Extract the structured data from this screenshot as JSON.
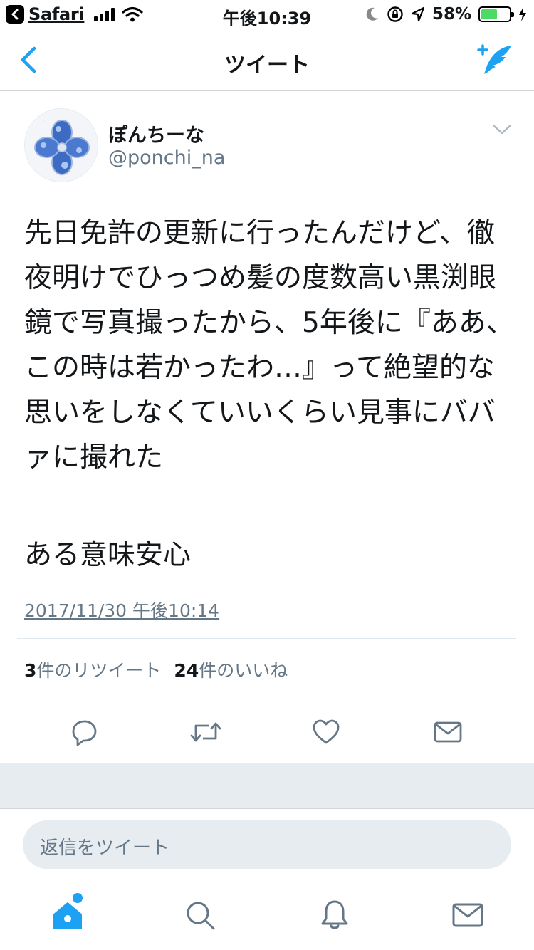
{
  "status_bar": {
    "back_app": "Safari",
    "time": "午後10:39",
    "battery": "58%",
    "battery_level": 0.58
  },
  "nav": {
    "title": "ツイート"
  },
  "tweet": {
    "display_name": "ぽんちーな",
    "screen_name": "@ponchi_na",
    "text": "先日免許の更新に行ったんだけど、徹夜明けでひっつめ髪の度数高い黒渕眼鏡で写真撮ったから、5年後に『ああ、この時は若かったわ…』って絶望的な思いをしなくていいくらい見事にババァに撮れた",
    "text_2": "ある意味安心",
    "timestamp": "2017/11/30 午後10:14",
    "retweet_count": "3",
    "retweet_label": "件のリツイート",
    "like_count": "24",
    "like_label": "件のいいね"
  },
  "reply": {
    "placeholder": "返信をツイート"
  },
  "colors": {
    "accent": "#1da1f2",
    "icon_gray": "#657786",
    "gap_background": "#e6ecf0"
  },
  "icons": {
    "actions": [
      "reply-icon",
      "retweet-icon",
      "like-icon",
      "dm-icon"
    ],
    "tabs": [
      "home-icon",
      "search-icon",
      "notifications-icon",
      "messages-icon"
    ]
  }
}
